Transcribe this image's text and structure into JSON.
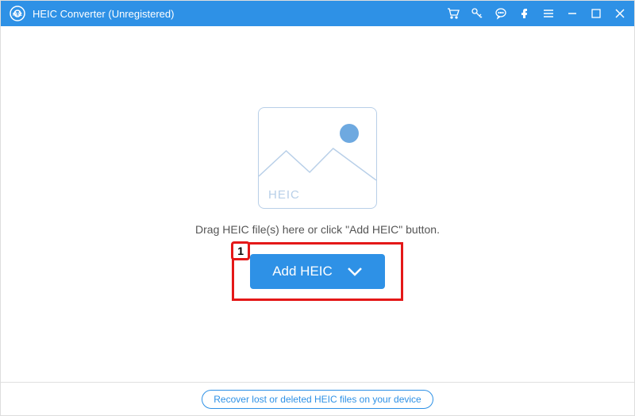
{
  "titlebar": {
    "title": "HEIC Converter (Unregistered)"
  },
  "main": {
    "placeholder_label": "HEIC",
    "drag_text": "Drag HEIC file(s) here or click \"Add HEIC\" button.",
    "add_button_label": "Add HEIC",
    "annotation_number": "1"
  },
  "footer": {
    "recover_link": "Recover lost or deleted HEIC files on your device"
  }
}
